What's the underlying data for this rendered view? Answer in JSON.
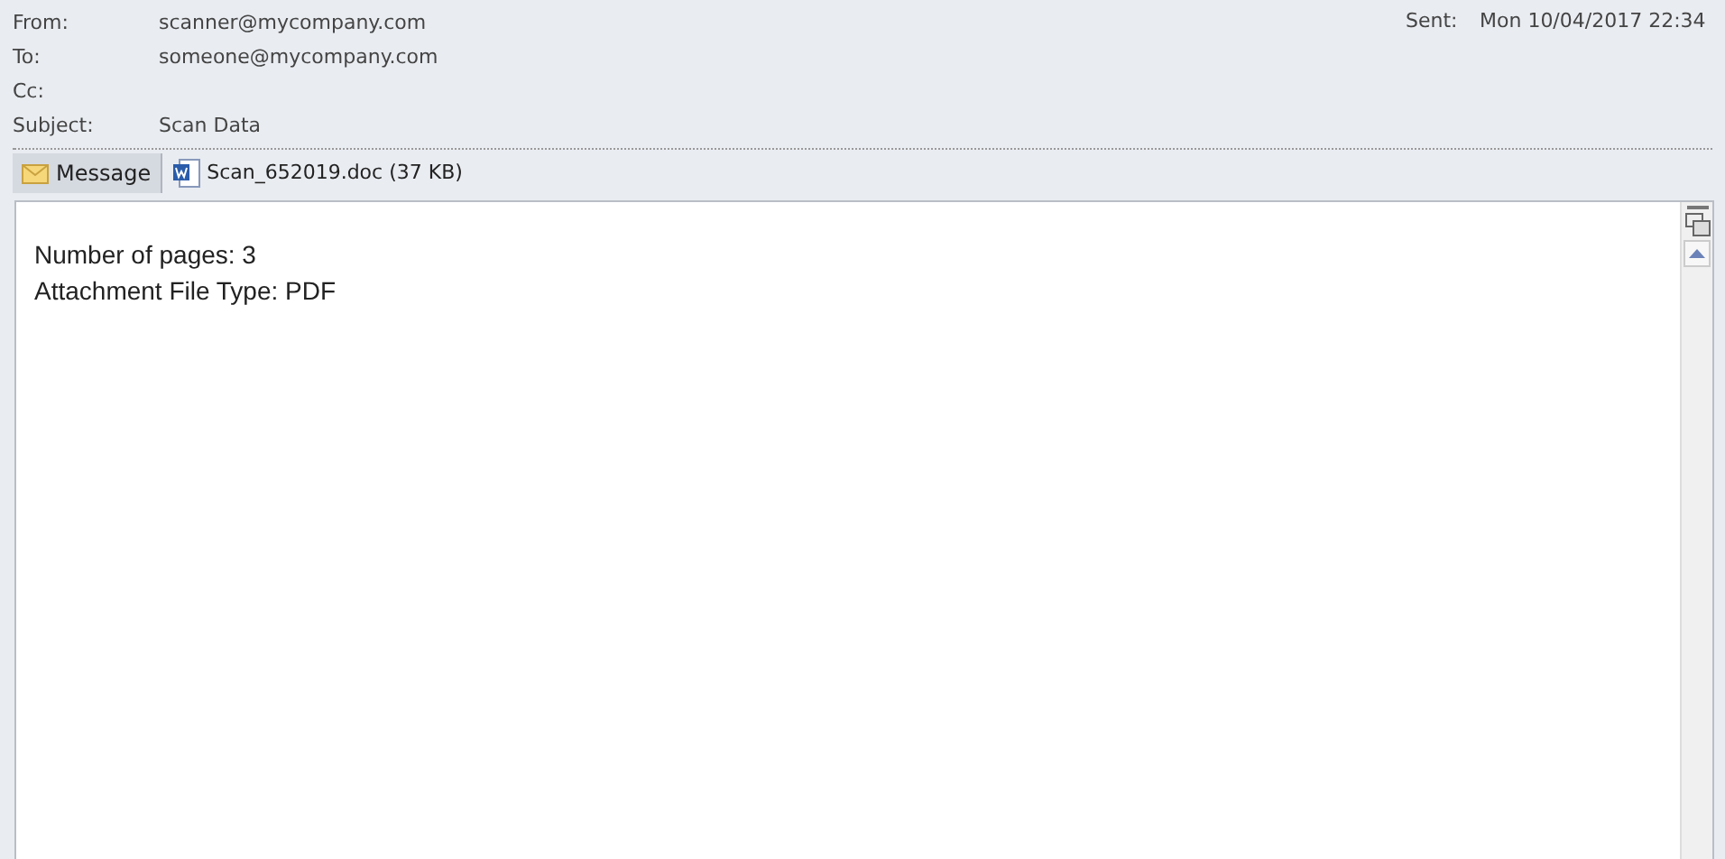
{
  "header": {
    "fields": [
      {
        "label": "From:",
        "value": "scanner@mycompany.com"
      },
      {
        "label": "To:",
        "value": "someone@mycompany.com"
      },
      {
        "label": "Cc:"
      },
      {
        "label": "Subject:",
        "value": "Scan Data"
      }
    ],
    "sent": {
      "label": "Sent:",
      "value": "Mon 10/04/2017 22:34"
    }
  },
  "attachments": [
    {
      "kind": "message",
      "label": "Message",
      "selected": true
    },
    {
      "kind": "file",
      "label": "Scan_652019.doc (37 KB)",
      "selected": false
    }
  ],
  "body": {
    "lines": [
      "Number of pages: 3",
      "Attachment File Type: PDF"
    ]
  }
}
